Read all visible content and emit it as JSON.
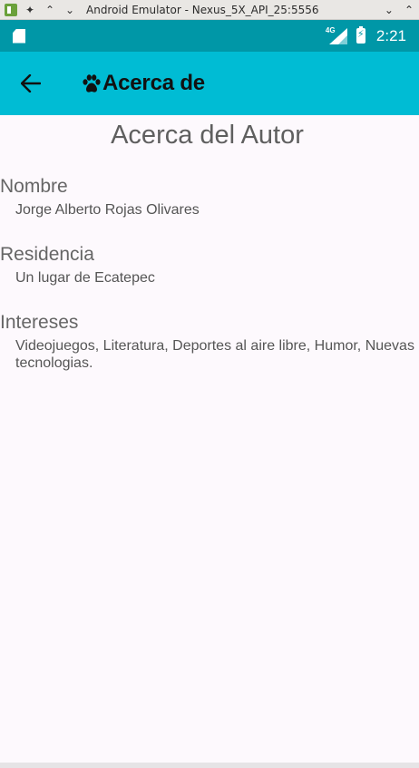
{
  "window": {
    "title": "Android Emulator - Nexus_5X_API_25:5556"
  },
  "status_bar": {
    "network": "4G",
    "time": "2:21"
  },
  "app_bar": {
    "title": "Acerca de",
    "back_icon": "arrow-back-icon",
    "title_icon": "paw-icon"
  },
  "content": {
    "heading": "Acerca del Autor",
    "sections": [
      {
        "label": "Nombre",
        "value": "Jorge Alberto Rojas Olivares"
      },
      {
        "label": "Residencia",
        "value": "Un lugar de Ecatepec"
      },
      {
        "label": "Intereses",
        "value": "Videojuegos, Literatura, Deportes al aire libre, Humor, Nuevas tecnologias."
      }
    ]
  },
  "colors": {
    "status_bar": "#0097a7",
    "app_bar": "#00bcd4",
    "background": "#fdf9fd"
  }
}
